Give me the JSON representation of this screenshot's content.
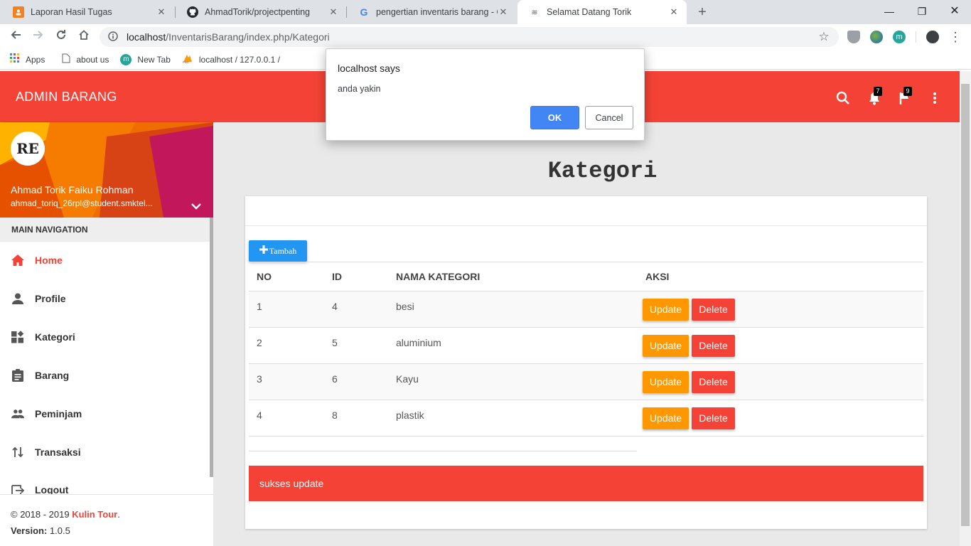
{
  "browser": {
    "tabs": [
      {
        "title": "Laporan Hasil Tugas",
        "icon": "orange-doc-icon"
      },
      {
        "title": "AhmadTorik/projectpenting",
        "icon": "github-icon"
      },
      {
        "title": "pengertian inventaris barang - Go",
        "icon": "google-icon"
      },
      {
        "title": "Selamat Datang Torik",
        "icon": "localhost-icon"
      }
    ],
    "url_host": "localhost",
    "url_path": "/InventarisBarang/index.php/Kategori",
    "bookmarks": [
      "Apps",
      "about us",
      "New Tab",
      "localhost / 127.0.0.1 /"
    ],
    "extension_letter": "m"
  },
  "header": {
    "brand": "ADMIN BARANG",
    "notifications_count": "7",
    "flags_count": "9",
    "color": "#f44336"
  },
  "user": {
    "avatar_text": "RE",
    "name": "Ahmad Torik Faiku Rohman",
    "email": "ahmad_toriq_26rpl@student.smktel..."
  },
  "sidebar": {
    "nav_header": "MAIN NAVIGATION",
    "items": [
      {
        "label": "Home",
        "icon": "home-icon"
      },
      {
        "label": "Profile",
        "icon": "person-icon"
      },
      {
        "label": "Kategori",
        "icon": "widgets-icon"
      },
      {
        "label": "Barang",
        "icon": "clipboard-icon"
      },
      {
        "label": "Peminjam",
        "icon": "people-icon"
      },
      {
        "label": "Transaksi",
        "icon": "swap-icon"
      },
      {
        "label": "Logout",
        "icon": "exit-icon"
      }
    ],
    "footer": {
      "copyright": "© 2018 - 2019 ",
      "company": "Kulin Tour",
      "period": ".",
      "version_label": "Version:",
      "version": " 1.0.5"
    }
  },
  "main": {
    "title": "Kategori",
    "add_button": "Tambah",
    "table": {
      "headers": [
        "NO",
        "ID",
        "NAMA KATEGORI",
        "AKSI"
      ],
      "rows": [
        {
          "no": "1",
          "id": "4",
          "nama": "besi"
        },
        {
          "no": "2",
          "id": "5",
          "nama": "aluminium"
        },
        {
          "no": "3",
          "id": "6",
          "nama": "Kayu"
        },
        {
          "no": "4",
          "id": "8",
          "nama": "plastik"
        }
      ],
      "update_label": "Update",
      "delete_label": "Delete"
    },
    "alert": "sukses update"
  },
  "dialog": {
    "title": "localhost says",
    "message": "anda yakin",
    "ok": "OK",
    "cancel": "Cancel"
  }
}
